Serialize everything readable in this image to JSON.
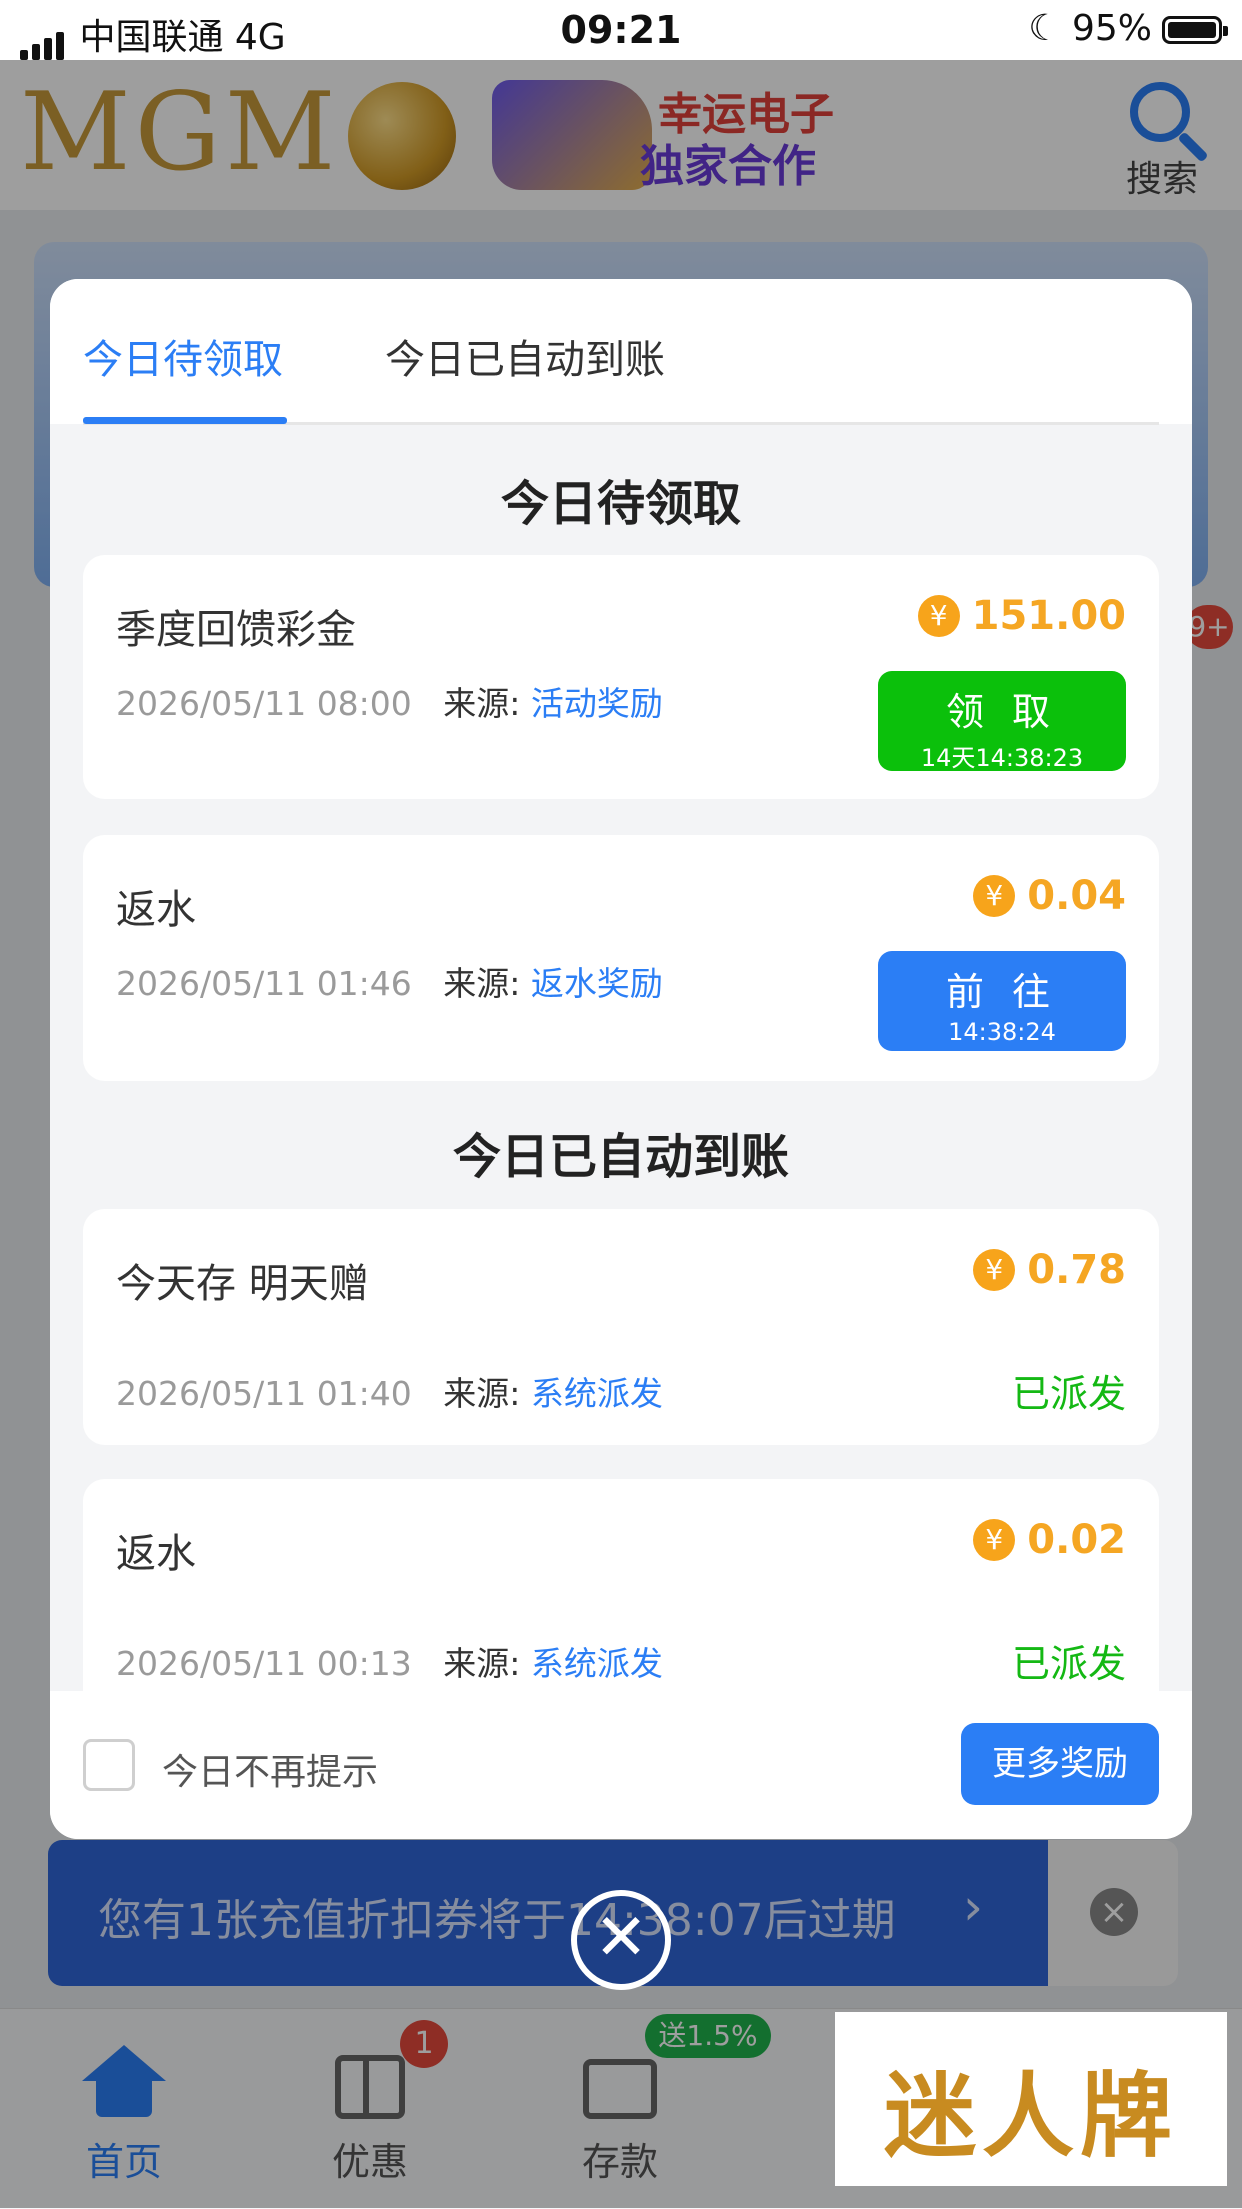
{
  "status_bar": {
    "carrier": "中国联通   4G",
    "time": "09:21",
    "battery": "95%"
  },
  "app_header": {
    "logo": "MGM",
    "promo_line1": "幸运电子",
    "promo_line2": "独家合作",
    "search_label": "搜索"
  },
  "modal": {
    "tabs": [
      {
        "label": "今日待领取"
      },
      {
        "label": "今日已自动到账"
      }
    ],
    "pending_title": "今日待领取",
    "pending": [
      {
        "name": "季度回馈彩金",
        "amount": "151.00",
        "date": "2026/05/11 08:00",
        "source_label": "来源:",
        "source": "活动奖励",
        "button_label": "领 取",
        "button_timer": "14天14:38:23"
      },
      {
        "name": "返水",
        "amount": "0.04",
        "date": "2026/05/11 01:46",
        "source_label": "来源:",
        "source": "返水奖励",
        "button_label": "前 往",
        "button_timer": "14:38:24"
      }
    ],
    "auto_title": "今日已自动到账",
    "auto": [
      {
        "name": "今天存 明天赠",
        "amount": "0.78",
        "date": "2026/05/11 01:40",
        "source_label": "来源:",
        "source": "系统派发",
        "status": "已派发"
      },
      {
        "name": "返水",
        "amount": "0.02",
        "date": "2026/05/11 00:13",
        "source_label": "来源:",
        "source": "系统派发",
        "status": "已派发"
      }
    ],
    "dont_remind_label": "今日不再提示",
    "more_rewards_label": "更多奖励",
    "yen_symbol": "¥"
  },
  "coupon_bar": {
    "text": "您有1张充值折扣券将于14:38:07后过期",
    "arrow": "›",
    "close": "×"
  },
  "close_symbol": "✕",
  "bottom_tabs": [
    {
      "label": "首页"
    },
    {
      "label": "优惠",
      "badge": "1"
    },
    {
      "label": "存款",
      "badge": "送1.5%"
    }
  ],
  "watermark": "迷人牌",
  "colors": {
    "accent": "#2b7ef5",
    "gold": "#f5a623",
    "green": "#0bc00b"
  }
}
